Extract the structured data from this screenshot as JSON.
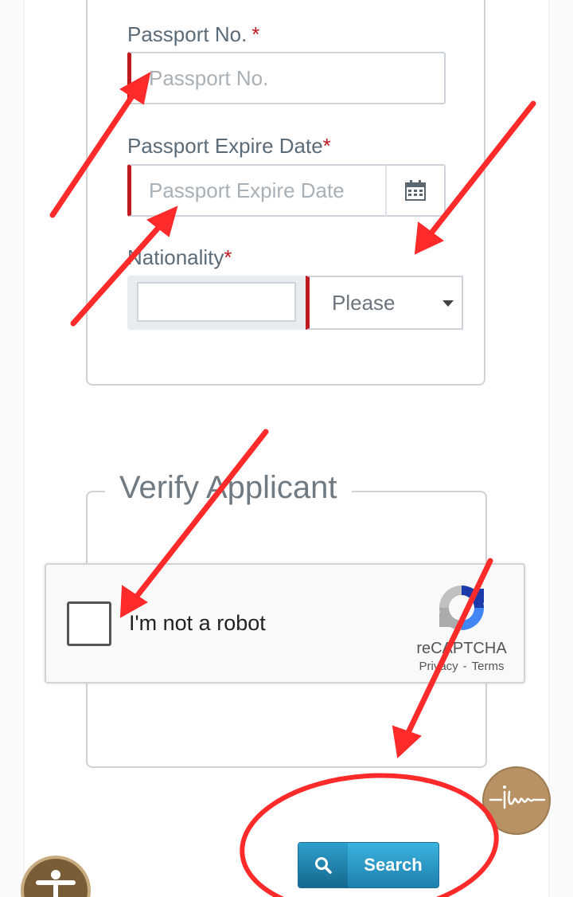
{
  "form": {
    "passport_no": {
      "label": "Passport No.",
      "required_mark": "*",
      "placeholder": "Passport No.",
      "value": ""
    },
    "passport_expiry": {
      "label": "Passport Expire Date",
      "required_mark": "*",
      "placeholder": "Passport Expire Date",
      "value": ""
    },
    "nationality": {
      "label": "Nationality",
      "required_mark": "*",
      "code_value": "",
      "select_value": "Please"
    }
  },
  "verify": {
    "legend": "Verify Applicant",
    "recaptcha": {
      "label": "I'm not a robot",
      "brand": "reCAPTCHA",
      "privacy": "Privacy",
      "separator": "-",
      "terms": "Terms"
    }
  },
  "actions": {
    "search_label": "Search"
  },
  "colors": {
    "required": "#c0191f",
    "search_button": "#1d7fae",
    "annotation": "#ff2a2a"
  }
}
